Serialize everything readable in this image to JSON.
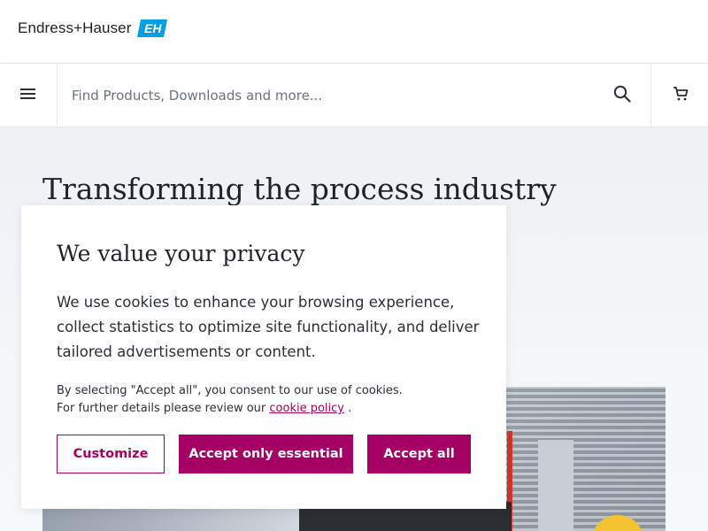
{
  "brand": {
    "name": "Endress+Hauser",
    "mark": "EH",
    "accent_color": "#009fe3"
  },
  "search": {
    "placeholder": "Find Products, Downloads and more...",
    "value": ""
  },
  "icons": {
    "menu": "hamburger-menu-icon",
    "search": "search-icon",
    "cart": "shopping-cart-icon"
  },
  "hero": {
    "title": "Transforming the process industry through"
  },
  "privacy_dialog": {
    "title": "We value your privacy",
    "body": "We use cookies to enhance your browsing experience, collect statistics to optimize site functionality, and deliver tailored advertisements or content.",
    "consent_line1": "By selecting \"Accept all\", you consent to our use of cookies.",
    "consent_line2_prefix": "For further details please review our",
    "cookie_policy_link": "cookie policy",
    "consent_line2_suffix": ".",
    "buttons": {
      "customize": "Customize",
      "accept_essential": "Accept only essential",
      "accept_all": "Accept all"
    },
    "button_color": "#a50063"
  }
}
